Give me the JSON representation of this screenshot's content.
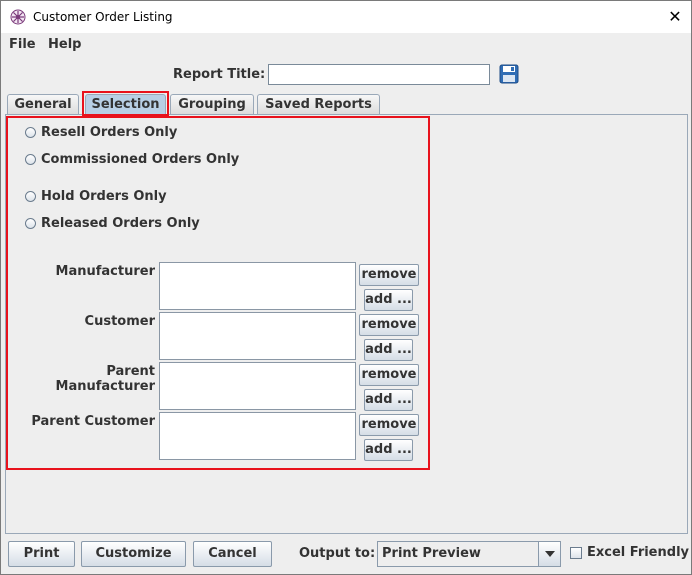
{
  "window": {
    "title": "Customer Order Listing",
    "close_glyph": "✕",
    "app_icon": "app-flower-icon"
  },
  "menu": {
    "items": [
      "File",
      "Help"
    ]
  },
  "header": {
    "report_title_label": "Report Title:",
    "report_title_value": "",
    "save_icon": "floppy-disk-icon"
  },
  "tabs": [
    {
      "label": "General",
      "selected": false
    },
    {
      "label": "Selection",
      "selected": true
    },
    {
      "label": "Grouping",
      "selected": false
    },
    {
      "label": "Saved Reports",
      "selected": false
    }
  ],
  "selection": {
    "radios": [
      {
        "label": "Resell Orders Only",
        "checked": false
      },
      {
        "label": "Commissioned Orders Only",
        "checked": false
      },
      {
        "label": "Hold Orders Only",
        "checked": false
      },
      {
        "label": "Released Orders Only",
        "checked": false
      }
    ],
    "filters": [
      {
        "label": "Manufacturer",
        "remove": "remove",
        "add": "add ..."
      },
      {
        "label": "Customer",
        "remove": "remove",
        "add": "add ..."
      },
      {
        "label": "Parent Manufacturer",
        "remove": "remove",
        "add": "add ..."
      },
      {
        "label": "Parent Customer",
        "remove": "remove",
        "add": "add ..."
      }
    ]
  },
  "footer": {
    "print": "Print",
    "customize": "Customize",
    "cancel": "Cancel",
    "output_label": "Output to:",
    "output_value": "Print Preview",
    "excel_friendly": "Excel Friendly",
    "excel_checked": false
  },
  "colors": {
    "highlight_border": "#e8121c",
    "selected_tab": "#b8cfe5"
  }
}
